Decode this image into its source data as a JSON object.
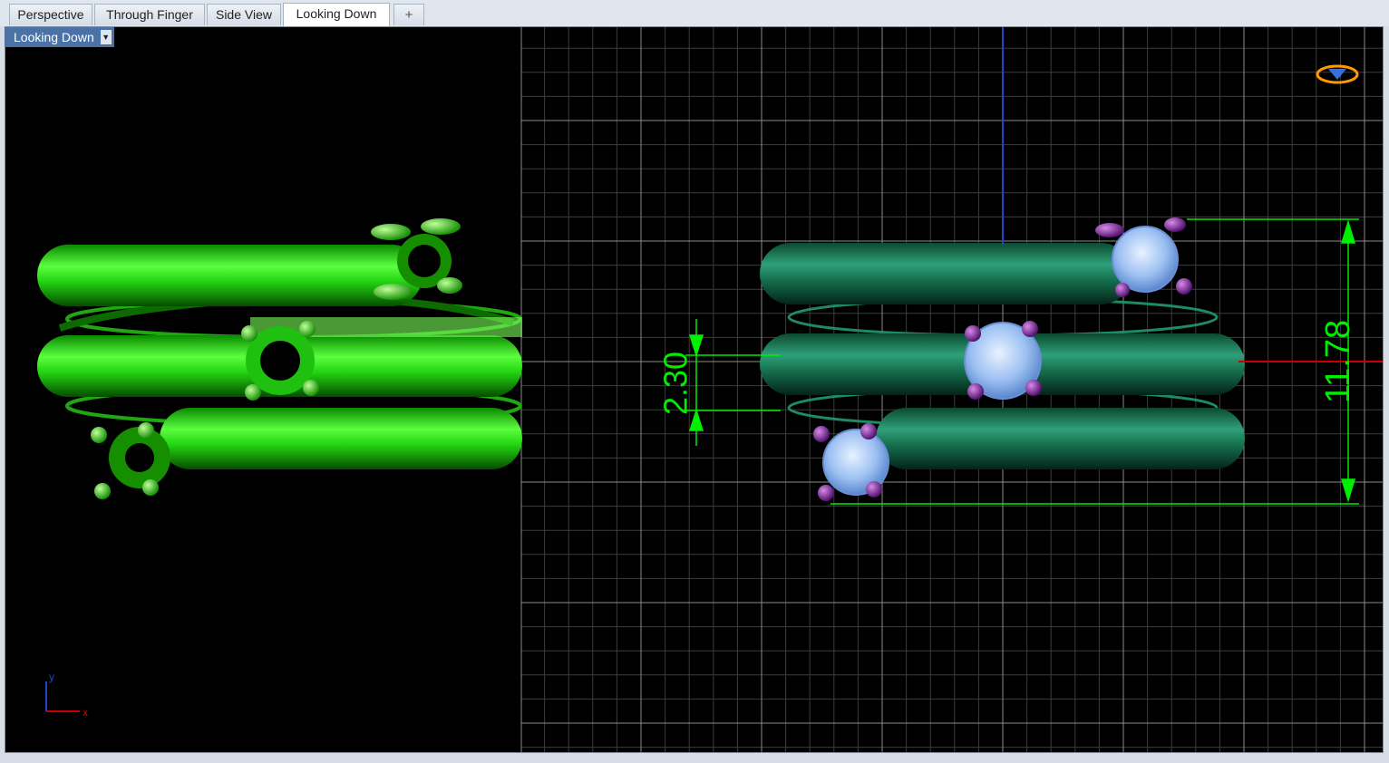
{
  "tabs": [
    {
      "label": "Perspective",
      "active": false
    },
    {
      "label": "Through Finger",
      "active": false
    },
    {
      "label": "Side View",
      "active": false
    },
    {
      "label": "Looking Down",
      "active": true
    }
  ],
  "add_tab_icon": "plus-icon",
  "viewport": {
    "label": "Looking Down",
    "dropdown_icon": "chevron-down-icon",
    "background_color": "#000000",
    "grid_color": "#8c8c8c",
    "left_model_color": "#22dd11",
    "right_model_color": "#116644",
    "stone_color": "#aaccff",
    "prong_color": "#7a1a9a",
    "dimension_color": "#00ee00"
  },
  "dimensions": {
    "height_label": "11.78",
    "spacing_label": "2.30"
  },
  "axes": {
    "x_label": "x",
    "y_label": "y",
    "x_color": "#cc0000",
    "y_color": "#2244cc"
  },
  "gumball_icon": "gem-icon"
}
